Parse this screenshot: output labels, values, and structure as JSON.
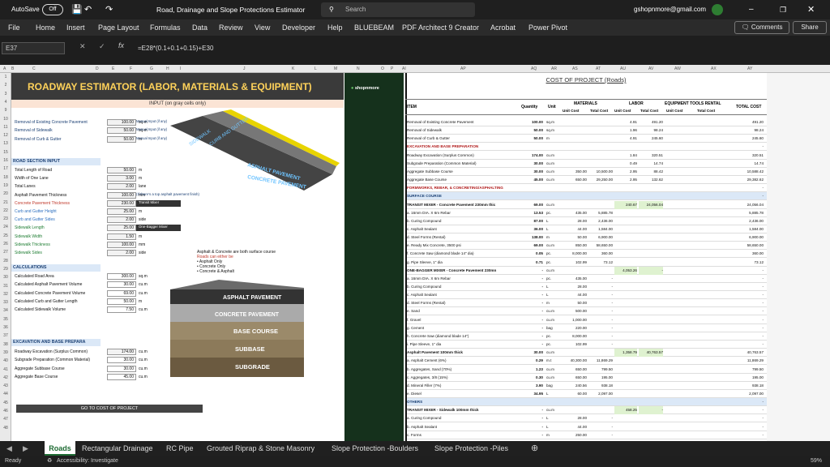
{
  "titlebar": {
    "autosave_label": "AutoSave",
    "autosave_state": "Off",
    "doc_title": "Road, Drainage and Slope Protections Estimator",
    "search_placeholder": "Search",
    "account": "gshopnmore@gmail.com"
  },
  "menu": [
    "File",
    "Home",
    "Insert",
    "Page Layout",
    "Formulas",
    "Data",
    "Review",
    "View",
    "Developer",
    "Help",
    "BLUEBEAM",
    "PDF Architect 9 Creator",
    "Acrobat",
    "Power Pivot"
  ],
  "comments_label": "Comments",
  "share_label": "Share",
  "namebox": "E37",
  "formula": "=E28*(0.1+0.1+0.15)+E30",
  "sheet": {
    "col_headers": [
      "A",
      "B",
      "C",
      "D",
      "E",
      "F",
      "G",
      "H",
      "I",
      "J",
      "K",
      "L",
      "M",
      "N",
      "O",
      "P",
      "AI",
      "AP",
      "AQ",
      "AR",
      "AS",
      "AT",
      "AU",
      "AV",
      "AW",
      "AX",
      "AY"
    ],
    "row_headers": [
      "1",
      "2",
      "3",
      "4",
      "9",
      "10",
      "11",
      "12",
      "13",
      "15",
      "16",
      "17",
      "18",
      "19",
      "20",
      "21",
      "22",
      "23",
      "24",
      "25",
      "26",
      "27",
      "28",
      "29",
      "30",
      "31",
      "32",
      "33",
      "34",
      "35",
      "36",
      "37",
      "38",
      "39",
      "40",
      "41",
      "42",
      "43",
      "44",
      "45",
      "46",
      "47",
      "48"
    ],
    "left_title": "ROADWAY ESTIMATOR (LABOR, MATERIALS & EQUIPMENT)",
    "input_note": "INPUT (on gray cells only)",
    "removals": [
      {
        "label": "Removal of Existing Concrete Pavement",
        "value": "100.00",
        "unit": "sq.m",
        "note": "Manual Input (if any)"
      },
      {
        "label": "Removal of Sidewalk",
        "value": "50.00",
        "unit": "sq.m",
        "note": "Manual Input (if any)"
      },
      {
        "label": "Removal of Curb & Gutter",
        "value": "50.00",
        "unit": "m",
        "note": "Manual Input (if any)"
      }
    ],
    "road_section_title": "ROAD SECTION INPUT",
    "road_inputs": [
      {
        "label": "Total Length of Road",
        "value": "50.00",
        "unit": "m"
      },
      {
        "label": "Width of One Lane",
        "value": "3.00",
        "unit": "m"
      },
      {
        "label": "Total Lanes",
        "value": "2.00",
        "unit": "lane"
      },
      {
        "label": "Asphalt Pavement Thickness",
        "value": "100.00",
        "unit": "mm",
        "note": "(If there's a top asphalt pavement finish)"
      },
      {
        "label": "Concrete Pavement Thickness",
        "value": "230.00",
        "unit": "mm",
        "note": "Transit Mixer"
      },
      {
        "label": "Curb and Gutter Height",
        "value": "25.00",
        "unit": "m"
      },
      {
        "label": "Curb and Gutter Sides",
        "value": "2.00",
        "unit": "side"
      },
      {
        "label": "Sidewalk Length",
        "value": "25.00",
        "unit": "m",
        "note": "One-Bagger Mixer"
      },
      {
        "label": "Sidewalk Width",
        "value": "1.50",
        "unit": "m"
      },
      {
        "label": "Sidewalk Thickness",
        "value": "100.00",
        "unit": "mm"
      },
      {
        "label": "Sidewalk Sides",
        "value": "2.00",
        "unit": "side"
      }
    ],
    "calc_title": "CALCULATIONS",
    "calcs": [
      {
        "label": "Calculated Road Area",
        "value": "300.00",
        "unit": "sq.m"
      },
      {
        "label": "Calculated Asphalt Pavement Volume",
        "value": "30.00",
        "unit": "cu.m"
      },
      {
        "label": "Calculated Concrete Pavement Volume",
        "value": "69.00",
        "unit": "cu.m"
      },
      {
        "label": "Calculated Curb and Gutter Length",
        "value": "50.00",
        "unit": "m"
      },
      {
        "label": "Calculated Sidewalk Volume",
        "value": "7.50",
        "cu.m": "",
        "unit": "cu.m"
      }
    ],
    "exc_title": "EXCAVATION AND BASE PREPARA",
    "exc": [
      {
        "label": "Roadway Excavation (Surplus Common)",
        "value": "174.00",
        "unit": "cu.m"
      },
      {
        "label": "Subgrade Preparation (Common Material)",
        "value": "30.00",
        "unit": "cu.m"
      },
      {
        "label": "Aggregate Subbase Course",
        "value": "30.00",
        "unit": "cu.m"
      },
      {
        "label": "Aggregate Base Course",
        "value": "45.00",
        "unit": "cu.m"
      }
    ],
    "goto_label": "GO TO COST OF PROJECT",
    "surface_note": {
      "line1": "Asphalt & Concrete are both surface course",
      "line2": "Roads can either be",
      "opts": [
        "• Asphalt Only",
        "• Concrete Only",
        "• Concrete & Asphalt"
      ]
    },
    "illustration_top": {
      "l1": "SIDEWALK",
      "l2": "CURB AND GUTTER",
      "l3": "ASPHALT PAVEMENT",
      "l4": "CONCRETE PAVEMENT"
    },
    "illustration_bottom": {
      "l1": "ASPHALT PAVEMENT",
      "l2": "CONCRETE PAVEMENT",
      "l3": "BASE COURSE",
      "l4": "SUBBASE",
      "l5": "SUBGRADE"
    },
    "logo_text": "shopnmore",
    "cost_title": "COST OF PROJECT (Roads)",
    "cost_headers": {
      "item": "ITEM",
      "qty": "Quantity",
      "unit": "Unit",
      "materials": "MATERIALS",
      "labor": "LABOR",
      "equip": "EQUIPMENT TOOLS RENTAL",
      "total": "TOTAL COST",
      "unit_cost": "Unit Cost",
      "total_cost": "Total Cost"
    },
    "cost_rows": [
      {
        "item": "Removal of Existing Concrete Pavement",
        "qty": "100.00",
        "unit": "sq.m",
        "m_uc": "",
        "m_tc": "",
        "l_uc": "4.91",
        "l_tc": "491.20",
        "e_tc": "",
        "total": "491.20"
      },
      {
        "item": "Removal of Sidewalk",
        "qty": "50.00",
        "unit": "sq.m",
        "m_uc": "",
        "m_tc": "",
        "l_uc": "1.96",
        "l_tc": "98.24",
        "e_tc": "",
        "total": "98.24"
      },
      {
        "item": "Removal of Curb & Gutter",
        "qty": "50.00",
        "unit": "m",
        "m_uc": "",
        "m_tc": "",
        "l_uc": "4.91",
        "l_tc": "245.60",
        "e_tc": "",
        "total": "245.60"
      },
      {
        "item": "EXCAVATION AND BASE PREPARATION",
        "qty": "",
        "unit": "",
        "m_uc": "",
        "m_tc": "",
        "l_uc": "",
        "l_tc": "",
        "e_tc": "",
        "total": "-",
        "style": "red"
      },
      {
        "item": "Roadway Excavation (Surplus Common)",
        "qty": "174.00",
        "unit": "cu.m",
        "m_uc": "",
        "m_tc": "",
        "l_uc": "1.84",
        "l_tc": "320.51",
        "e_tc": "",
        "total": "320.51"
      },
      {
        "item": "Subgrade Preparation (Common Material)",
        "qty": "30.00",
        "unit": "cu.m",
        "m_uc": "",
        "m_tc": "",
        "l_uc": "0.49",
        "l_tc": "14.74",
        "e_tc": "",
        "total": "14.74"
      },
      {
        "item": "Aggregate Subbase Course",
        "qty": "30.00",
        "unit": "cu.m",
        "m_uc": "350.00",
        "m_tc": "10,500.00",
        "l_uc": "2.95",
        "l_tc": "88.42",
        "e_tc": "",
        "total": "10,588.42"
      },
      {
        "item": "Aggregate Base Course",
        "qty": "45.00",
        "unit": "cu.m",
        "m_uc": "650.00",
        "m_tc": "29,250.00",
        "l_uc": "2.95",
        "l_tc": "132.62",
        "e_tc": "",
        "total": "29,382.62"
      },
      {
        "item": "FORMWORKS, REBAR, & CONCRETING/ASPHALTING",
        "qty": "",
        "unit": "",
        "m_uc": "",
        "m_tc": "",
        "l_uc": "",
        "l_tc": "",
        "e_tc": "",
        "total": "-",
        "style": "red"
      },
      {
        "item": "SURFACE COURSE",
        "qty": "",
        "unit": "",
        "m_uc": "",
        "m_tc": "",
        "l_uc": "",
        "l_tc": "",
        "e_tc": "",
        "total": "-",
        "style": "blue"
      },
      {
        "item": "TRANSIT MIXER - Concrete Pavement 230mm thic",
        "qty": "69.00",
        "unit": "cu.m",
        "m_uc": "",
        "m_tc": "",
        "l_uc": "240.67",
        "l_tc": "24,056.04",
        "e_tc": "",
        "total": "24,056.04",
        "style": "bold"
      },
      {
        "item": "a. 16mm DIA. X 6m Rebar",
        "qty": "13.53",
        "unit": "pc.",
        "m_uc": "435.00",
        "m_tc": "5,885.78",
        "l_uc": "",
        "l_tc": "",
        "e_tc": "",
        "total": "5,885.78"
      },
      {
        "item": "b. Curing Compound",
        "qty": "87.00",
        "unit": "L",
        "m_uc": "28.00",
        "m_tc": "2,436.00",
        "l_uc": "",
        "l_tc": "",
        "e_tc": "",
        "total": "2,436.00"
      },
      {
        "item": "c. Asphalt Sealant",
        "qty": "36.00",
        "unit": "L",
        "m_uc": "44.00",
        "m_tc": "1,584.00",
        "l_uc": "",
        "l_tc": "",
        "e_tc": "",
        "total": "1,584.00"
      },
      {
        "item": "d. Steel Forms (Rental)",
        "qty": "138.00",
        "unit": "m",
        "m_uc": "50.00",
        "m_tc": "6,900.00",
        "l_uc": "",
        "l_tc": "",
        "e_tc": "",
        "total": "6,900.00"
      },
      {
        "item": "e. Ready Mix Concrete, 3500 psi",
        "qty": "69.00",
        "unit": "cu.m",
        "m_uc": "850.00",
        "m_tc": "58,650.00",
        "l_uc": "",
        "l_tc": "",
        "e_tc": "",
        "total": "58,650.00"
      },
      {
        "item": "f. Concrete Saw (diamond blade 14\" dia)",
        "qty": "0.05",
        "unit": "pc.",
        "m_uc": "8,000.00",
        "m_tc": "360.00",
        "l_uc": "",
        "l_tc": "",
        "e_tc": "",
        "total": "360.00"
      },
      {
        "item": "g. Pipe Sleeve, 1\" dia",
        "qty": "0.71",
        "unit": "pc.",
        "m_uc": "102.99",
        "m_tc": "73.12",
        "l_uc": "",
        "l_tc": "",
        "e_tc": "",
        "total": "73.12"
      },
      {
        "item": "ONE-BAGGER MIXER - Concrete Pavement 230mn",
        "qty": "-",
        "unit": "cu.m",
        "m_uc": "",
        "m_tc": "",
        "l_uc": "4,053.26",
        "l_tc": "-",
        "e_tc": "",
        "total": "-",
        "style": "bold"
      },
      {
        "item": "a. 16mm DIA. X 6m Rebar",
        "qty": "-",
        "unit": "pc.",
        "m_uc": "435.00",
        "m_tc": "-",
        "l_uc": "",
        "l_tc": "",
        "e_tc": "",
        "total": "-"
      },
      {
        "item": "b. Curing Compound",
        "qty": "-",
        "unit": "L",
        "m_uc": "28.00",
        "m_tc": "-",
        "l_uc": "",
        "l_tc": "",
        "e_tc": "",
        "total": "-"
      },
      {
        "item": "c. Asphalt Sealant",
        "qty": "-",
        "unit": "L",
        "m_uc": "44.00",
        "m_tc": "-",
        "l_uc": "",
        "l_tc": "",
        "e_tc": "",
        "total": "-"
      },
      {
        "item": "d. Steel Forms (Rental)",
        "qty": "-",
        "unit": "m",
        "m_uc": "50.00",
        "m_tc": "-",
        "l_uc": "",
        "l_tc": "",
        "e_tc": "",
        "total": "-"
      },
      {
        "item": "e. Sand",
        "qty": "-",
        "unit": "cu.m",
        "m_uc": "500.00",
        "m_tc": "-",
        "l_uc": "",
        "l_tc": "",
        "e_tc": "",
        "total": "-"
      },
      {
        "item": "f. Gravel",
        "qty": "-",
        "unit": "cu.m",
        "m_uc": "1,000.00",
        "m_tc": "-",
        "l_uc": "",
        "l_tc": "",
        "e_tc": "",
        "total": "-"
      },
      {
        "item": "g. Cement",
        "qty": "-",
        "unit": "bag",
        "m_uc": "220.00",
        "m_tc": "-",
        "l_uc": "",
        "l_tc": "",
        "e_tc": "",
        "total": "-"
      },
      {
        "item": "h. Concrete Saw (diamond blade 14\")",
        "qty": "-",
        "unit": "pc.",
        "m_uc": "8,000.00",
        "m_tc": "-",
        "l_uc": "",
        "l_tc": "",
        "e_tc": "",
        "total": "-"
      },
      {
        "item": "i. Pipe Sleeve, 1\" dia",
        "qty": "-",
        "unit": "pc.",
        "m_uc": "102.99",
        "m_tc": "-",
        "l_uc": "",
        "l_tc": "",
        "e_tc": "",
        "total": "-"
      },
      {
        "item": "Asphalt Pavement 100mm thick",
        "qty": "30.00",
        "unit": "cu.m",
        "m_uc": "",
        "m_tc": "",
        "l_uc": "1,358.79",
        "l_tc": "40,763.57",
        "e_tc": "",
        "total": "40,763.57",
        "style": "bold"
      },
      {
        "item": "a. Asphalt Cement (6%)",
        "qty": "0.29",
        "unit": "m.t",
        "m_uc": "40,300.00",
        "m_tc": "11,869.29",
        "l_uc": "",
        "l_tc": "",
        "e_tc": "",
        "total": "11,869.29"
      },
      {
        "item": "b. Aggregates, Sand (70%)",
        "qty": "1.23",
        "unit": "cu.m",
        "m_uc": "650.00",
        "m_tc": "799.50",
        "l_uc": "",
        "l_tc": "",
        "e_tc": "",
        "total": "799.50"
      },
      {
        "item": "c. Aggregates, 3/8 (15%)",
        "qty": "0.30",
        "unit": "cu.m",
        "m_uc": "650.00",
        "m_tc": "195.00",
        "l_uc": "",
        "l_tc": "",
        "e_tc": "",
        "total": "195.00"
      },
      {
        "item": "d. Mineral Filler (7%)",
        "qty": "3.90",
        "unit": "bag",
        "m_uc": "240.56",
        "m_tc": "938.18",
        "l_uc": "",
        "l_tc": "",
        "e_tc": "",
        "total": "938.18"
      },
      {
        "item": "e. Diesel",
        "qty": "34.95",
        "unit": "L",
        "m_uc": "60.00",
        "m_tc": "2,097.00",
        "l_uc": "",
        "l_tc": "",
        "e_tc": "",
        "total": "2,097.00"
      },
      {
        "item": "OTHERS",
        "qty": "",
        "unit": "",
        "m_uc": "",
        "m_tc": "",
        "l_uc": "",
        "l_tc": "",
        "e_tc": "",
        "total": "-",
        "style": "blue"
      },
      {
        "item": "TRANSIT MIXER - Sidewalk 100mm thick",
        "qty": "-",
        "unit": "cu.m",
        "m_uc": "",
        "m_tc": "",
        "l_uc": "458.25",
        "l_tc": "-",
        "e_tc": "",
        "total": "-",
        "style": "bold"
      },
      {
        "item": "a. Curing Compound",
        "qty": "-",
        "unit": "L",
        "m_uc": "28.00",
        "m_tc": "-",
        "l_uc": "",
        "l_tc": "",
        "e_tc": "",
        "total": "-"
      },
      {
        "item": "b. Asphalt Sealant",
        "qty": "-",
        "unit": "L",
        "m_uc": "44.00",
        "m_tc": "-",
        "l_uc": "",
        "l_tc": "",
        "e_tc": "",
        "total": "-"
      },
      {
        "item": "c. Forms",
        "qty": "-",
        "unit": "m",
        "m_uc": "250.00",
        "m_tc": "-",
        "l_uc": "",
        "l_tc": "",
        "e_tc": "",
        "total": "-"
      },
      {
        "item": "d. Ready Mix Concrete, 3500 psi",
        "qty": "-",
        "unit": "cu.m",
        "m_uc": "850.00",
        "m_tc": "-",
        "l_uc": "",
        "l_tc": "",
        "e_tc": "",
        "total": "-"
      }
    ]
  },
  "tabs": [
    "Roads",
    "Rectangular Drainage",
    "RC Pipe",
    "Grouted Riprap & Stone Masonry",
    "Slope Protection -Boulders",
    "Slope Protection -Piles"
  ],
  "status": {
    "ready": "Ready",
    "accessibility": "Accessibility: Investigate",
    "zoom": "59%"
  },
  "colors": {
    "accent": "#1e6b33",
    "title_text": "#ffd25a",
    "title_bg": "#3a3a3a",
    "section_text": "#1a3f73"
  }
}
